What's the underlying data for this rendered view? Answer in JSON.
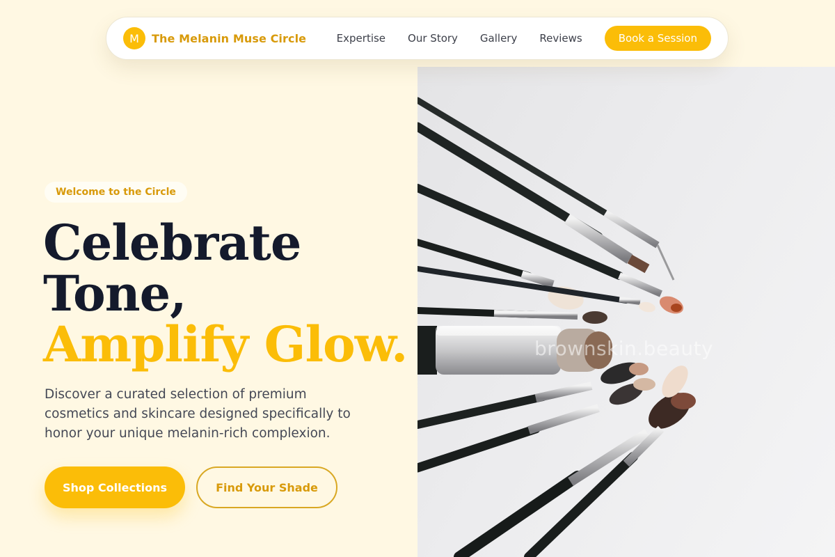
{
  "nav": {
    "brand_initial": "M",
    "brand_name": "The Melanin Muse Circle",
    "links": [
      "Expertise",
      "Our Story",
      "Gallery",
      "Reviews"
    ],
    "cta": "Book a Session"
  },
  "hero": {
    "badge": "Welcome to the Circle",
    "headline_line1": "Celebrate",
    "headline_line2": "Tone,",
    "headline_accent": "Amplify Glow.",
    "lede": "Discover a curated selection of premium cosmetics and skincare designed specifically to honor your unique melanin-rich complexion.",
    "primary_button": "Shop Collections",
    "secondary_button": "Find Your Shade",
    "image_watermark": "brownskin.beauty"
  },
  "colors": {
    "background": "#fff8e3",
    "accent": "#fbbd08",
    "brand_text": "#d89a0a",
    "heading": "#141a2c"
  }
}
